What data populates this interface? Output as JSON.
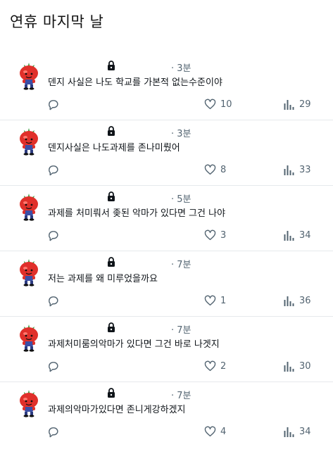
{
  "page": {
    "title": "연휴 마지막 날"
  },
  "posts": [
    {
      "time": "· 3분",
      "text": "덴지 사실은 나도 학교를 가본적 없는수준이야",
      "likes": "10",
      "views": "29"
    },
    {
      "time": "· 3분",
      "text": "덴지사실은 나도과제를 존나미뤘어",
      "likes": "8",
      "views": "33"
    },
    {
      "time": "· 5분",
      "text": "과제를 처미뤄서 좆된 악마가 있다면   그건 나야",
      "likes": "3",
      "views": "34"
    },
    {
      "time": "· 7분",
      "text": "저는 과제를 왜 미루었을까요",
      "likes": "1",
      "views": "36"
    },
    {
      "time": "· 7분",
      "text": "과제처미룸의악마가 있다면 그건 바로 나겟지",
      "likes": "2",
      "views": "30"
    },
    {
      "time": "· 7분",
      "text": "과제의악마가있다면 존니게강하겠지",
      "likes": "4",
      "views": "34"
    }
  ],
  "icons": {
    "avatar": "tomato-mascot-avatar",
    "lock": "lock-icon",
    "reply": "reply-icon",
    "like": "heart-icon",
    "views": "views-bar-chart-icon"
  },
  "colors": {
    "muted": "#536471",
    "tomato": "#e0302a",
    "leaf": "#3a9a3e",
    "divider": "#e6e9ec"
  }
}
